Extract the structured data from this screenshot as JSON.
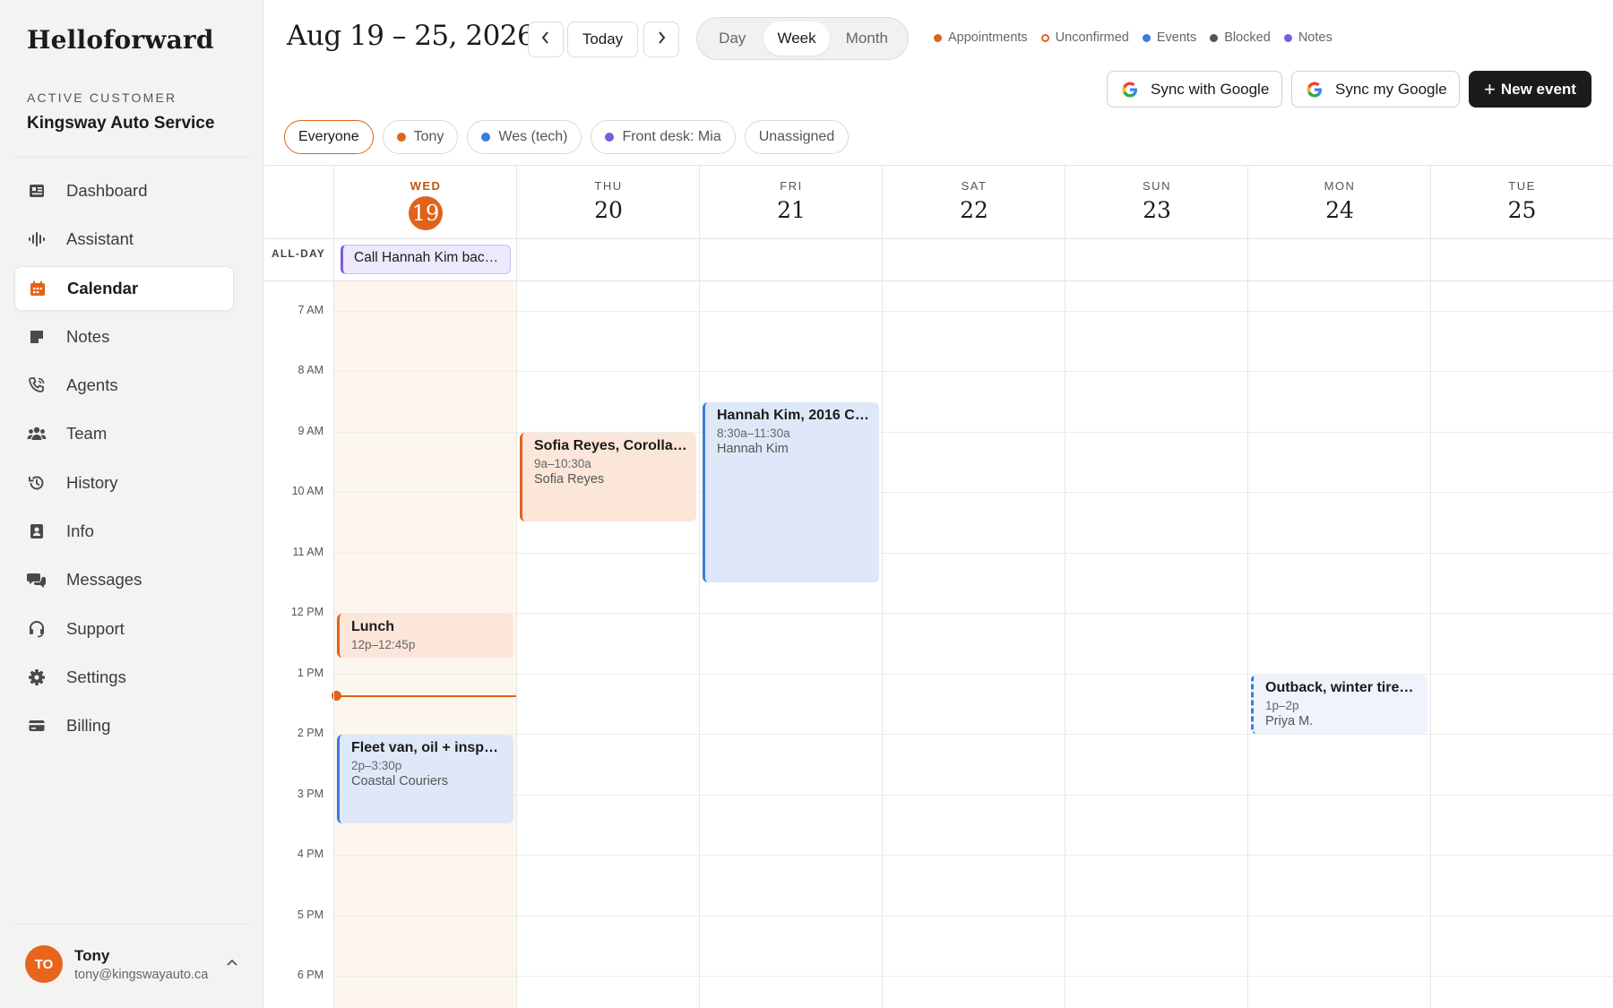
{
  "sidebar": {
    "brand": "Helloforward",
    "customer_label": "ACTIVE CUSTOMER",
    "customer_name": "Kingsway Auto Service",
    "items": [
      {
        "label": "Dashboard",
        "icon": "dashboard-icon"
      },
      {
        "label": "Assistant",
        "icon": "waveform-icon"
      },
      {
        "label": "Calendar",
        "icon": "calendar-icon",
        "active": true
      },
      {
        "label": "Notes",
        "icon": "note-icon"
      },
      {
        "label": "Agents",
        "icon": "phone-icon"
      },
      {
        "label": "Team",
        "icon": "team-icon"
      },
      {
        "label": "History",
        "icon": "history-icon"
      },
      {
        "label": "Info",
        "icon": "contact-card-icon"
      },
      {
        "label": "Messages",
        "icon": "chat-icon"
      },
      {
        "label": "Support",
        "icon": "headset-icon"
      },
      {
        "label": "Settings",
        "icon": "gear-icon"
      },
      {
        "label": "Billing",
        "icon": "credit-card-icon"
      }
    ],
    "user": {
      "initials": "TO",
      "name": "Tony",
      "email": "tony@kingswayauto.ca"
    }
  },
  "header": {
    "range_title": "Aug 19 – 25, 2026",
    "today_label": "Today",
    "views": [
      "Day",
      "Week",
      "Month"
    ],
    "active_view": "Week",
    "legend": [
      {
        "label": "Appointments",
        "color": "#e0631b",
        "style": "filled"
      },
      {
        "label": "Unconfirmed",
        "color": "#e0631b",
        "style": "outline"
      },
      {
        "label": "Events",
        "color": "#3b7be0",
        "style": "filled"
      },
      {
        "label": "Blocked",
        "color": "#555555",
        "style": "filled"
      },
      {
        "label": "Notes",
        "color": "#7b5be0",
        "style": "filled"
      }
    ],
    "sync_google_label": "Sync with Google",
    "sync_my_google_label": "Sync my Google",
    "new_event_label": "New event"
  },
  "filters": [
    {
      "label": "Everyone",
      "active": true
    },
    {
      "label": "Tony",
      "color": "#e0631b"
    },
    {
      "label": "Wes (tech)",
      "color": "#3b7be0"
    },
    {
      "label": "Front desk: Mia",
      "color": "#7b5be0"
    },
    {
      "label": "Unassigned"
    }
  ],
  "calendar": {
    "days": [
      {
        "dow": "WED",
        "dom": "19",
        "today": true
      },
      {
        "dow": "THU",
        "dom": "20"
      },
      {
        "dow": "FRI",
        "dom": "21"
      },
      {
        "dow": "SAT",
        "dom": "22"
      },
      {
        "dow": "SUN",
        "dom": "23"
      },
      {
        "dow": "MON",
        "dom": "24"
      },
      {
        "dow": "TUE",
        "dom": "25"
      }
    ],
    "allday_label": "ALL-DAY",
    "hours": [
      "7 AM",
      "8 AM",
      "9 AM",
      "10 AM",
      "11 AM",
      "12 PM",
      "1 PM",
      "2 PM",
      "3 PM",
      "4 PM",
      "5 PM",
      "6 PM"
    ],
    "allday_events": [
      {
        "day": 0,
        "title": "Call Hannah Kim back...",
        "type": "note"
      }
    ],
    "events": [
      {
        "day": 0,
        "title": "Lunch",
        "time": "12p–12:45p",
        "who": "",
        "start": 12.0,
        "end": 12.75,
        "type": "appointment"
      },
      {
        "day": 0,
        "title": "Fleet van, oil + inspec...",
        "time": "2p–3:30p",
        "who": "Coastal Couriers",
        "start": 14.0,
        "end": 15.5,
        "type": "event"
      },
      {
        "day": 1,
        "title": "Sofia Reyes, Corolla, ...",
        "time": "9a–10:30a",
        "who": "Sofia Reyes",
        "start": 9.0,
        "end": 10.5,
        "type": "appointment"
      },
      {
        "day": 2,
        "title": "Hannah Kim, 2016 Ci...",
        "time": "8:30a–11:30a",
        "who": "Hannah Kim",
        "start": 8.5,
        "end": 11.5,
        "type": "event"
      },
      {
        "day": 5,
        "title": "Outback, winter tires...",
        "time": "1p–2p",
        "who": "Priya M.",
        "start": 13.0,
        "end": 14.0,
        "type": "unconfirmed"
      }
    ],
    "now_hour": 13.37
  }
}
